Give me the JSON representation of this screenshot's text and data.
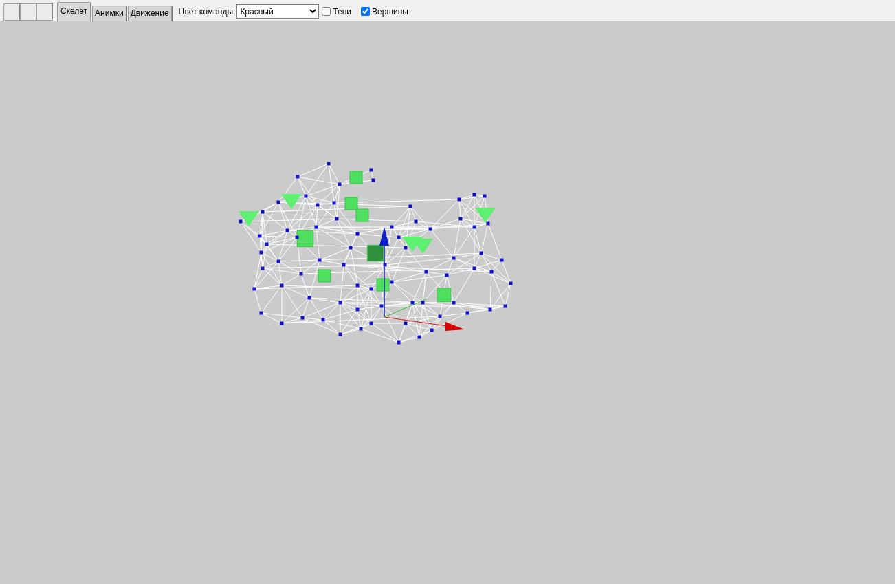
{
  "toolbar": {
    "buttons": [
      {
        "kind": "blank"
      },
      {
        "kind": "blank"
      },
      {
        "kind": "blank"
      }
    ]
  },
  "tabs": [
    {
      "label": "Скелет",
      "selected": true
    },
    {
      "label": "Анимки",
      "selected": false
    },
    {
      "label": "Движение",
      "selected": false
    }
  ],
  "team_color": {
    "label": "Цвет команды:",
    "value": "Красный"
  },
  "checkboxes": [
    {
      "label": "Тени",
      "checked": false
    },
    {
      "label": "Вершины",
      "checked": true
    }
  ]
}
